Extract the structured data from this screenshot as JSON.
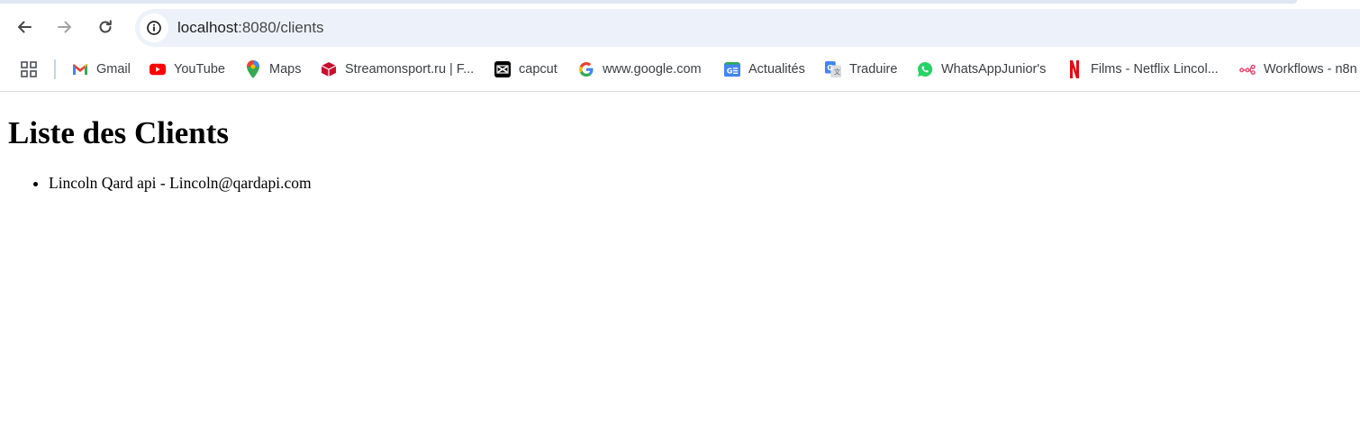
{
  "browser": {
    "url_host": "localhost",
    "url_rest": ":8080/clients",
    "bookmarks": [
      {
        "label": "Gmail",
        "icon": "gmail-icon"
      },
      {
        "label": "YouTube",
        "icon": "youtube-icon"
      },
      {
        "label": "Maps",
        "icon": "maps-icon"
      },
      {
        "label": "Streamonsport.ru | F...",
        "icon": "streamonsport-icon"
      },
      {
        "label": "capcut",
        "icon": "capcut-icon"
      },
      {
        "label": "www.google.com",
        "icon": "google-icon"
      },
      {
        "label": "Actualités",
        "icon": "news-icon"
      },
      {
        "label": "Traduire",
        "icon": "translate-icon"
      },
      {
        "label": "WhatsAppJunior's",
        "icon": "whatsapp-icon"
      },
      {
        "label": "Films - Netflix Lincol...",
        "icon": "netflix-icon"
      },
      {
        "label": "Workflows - n8n",
        "icon": "n8n-icon"
      }
    ]
  },
  "page": {
    "title": "Liste des Clients",
    "clients": [
      "Lincoln Qard api - Lincoln@qardapi.com"
    ]
  }
}
